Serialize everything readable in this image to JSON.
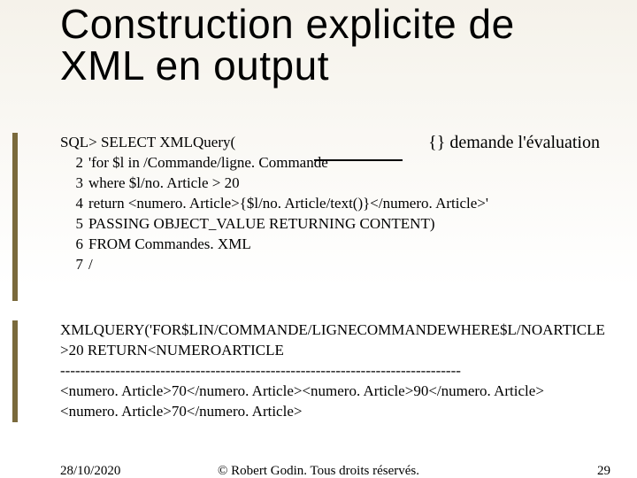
{
  "title": "Construction explicite de XML en output",
  "callout": "{} demande l'évaluation",
  "code": {
    "l1": "SQL> SELECT XMLQuery(",
    "n2": "2",
    "l2": "'for $l in /Commande/ligne. Commande",
    "n3": "3",
    "l3": "where $l/no. Article > 20",
    "n4": "4",
    "l4": "return <numero. Article>{$l/no. Article/text()}</numero. Article>'",
    "n5": "5",
    "l5": "PASSING OBJECT_VALUE RETURNING CONTENT)",
    "n6": "6",
    "l6": "FROM Commandes. XML",
    "n7": "7",
    "l7": "/"
  },
  "output": {
    "l1": "XMLQUERY('FOR$LIN/COMMANDE/LIGNECOMMANDEWHERE$L/NOARTICLE>20 RETURN<NUMEROARTICLE",
    "l2": "--------------------------------------------------------------------------------",
    "l3": "<numero. Article>70</numero. Article><numero. Article>90</numero. Article>",
    "l4": "<numero. Article>70</numero. Article>"
  },
  "footer": {
    "date": "28/10/2020",
    "copyright": "© Robert Godin. Tous droits réservés.",
    "page": "29"
  }
}
